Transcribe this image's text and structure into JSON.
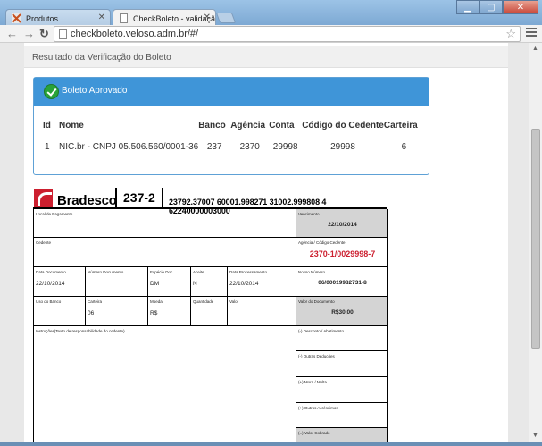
{
  "browser": {
    "tabs": [
      {
        "label": "Produtos"
      },
      {
        "label": "CheckBoleto - validação"
      }
    ],
    "url": "checkboleto.veloso.adm.br/#/"
  },
  "page": {
    "heading": "Resultado da Verificação do Boleto",
    "result": {
      "status": "Boleto Aprovado",
      "columns": [
        "Id",
        "Nome",
        "Banco",
        "Agência",
        "Conta",
        "Código do Cedente",
        "Carteira"
      ],
      "row": {
        "id": "1",
        "nome": "NIC.br - CNPJ 05.506.560/0001-36",
        "banco": "237",
        "agencia": "2370",
        "conta": "29998",
        "codigo_cedente": "29998",
        "carteira": "6"
      }
    },
    "boleto": {
      "bank_name": "Bradesco",
      "bank_code": "237-2",
      "linha_digitavel": "23792.37007 60001.998271 31002.999808 4 62240000003000",
      "labels": {
        "local_pagamento": "Local de Pagamento",
        "vencimento": "Vencimento",
        "cedente": "Cedente",
        "agencia_codigo": "Agência / Código Cedente",
        "data_documento": "Data Documento",
        "numero_documento": "Número Documento",
        "especie_doc": "Espécie Doc.",
        "aceite": "Aceite",
        "data_processamento": "Data Processamento",
        "nosso_numero": "Nosso Número",
        "uso_banco": "Uso do Banco",
        "carteira": "Carteira",
        "moeda": "Moeda",
        "quantidade": "Quantidade",
        "valor": "Valor",
        "valor_documento": "Valor do Documento",
        "instrucoes": "Instruções(Texto de responsabilidade do cedente)",
        "desconto": "(-) Desconto / Abatimento",
        "outras_deducoes": "(-) Outras Deduções",
        "mora_multa": "(+) Mora / Multa",
        "outros_acrescimos": "(+) Outros Acréscimos",
        "valor_cobrado": "(=) Valor Cobrado"
      },
      "values": {
        "vencimento": "22/10/2014",
        "agencia_codigo": "2370-1/0029998-7",
        "data_documento": "22/10/2014",
        "especie_doc": "DM",
        "aceite": "N",
        "data_processamento": "22/10/2014",
        "nosso_numero": "06/00019982731-8",
        "carteira": "06",
        "moeda": "R$",
        "valor_documento": "R$30,00"
      }
    }
  }
}
